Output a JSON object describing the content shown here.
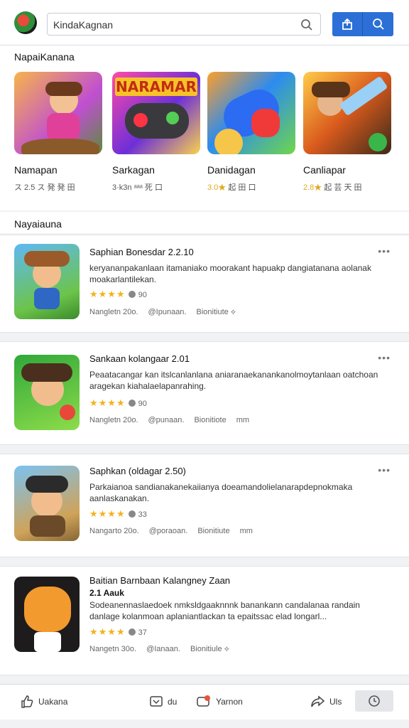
{
  "header": {
    "search_value": "KindaKagnan"
  },
  "featured": {
    "title": "NapaiKanana",
    "tiles": [
      {
        "name": "Namapan",
        "meta_highlight": "",
        "meta": "ス 2.5 ス 発 発 田"
      },
      {
        "name": "Sarkagan",
        "meta_highlight": "",
        "meta": "3·k3n ᵃᵃᵃ 死 口"
      },
      {
        "name": "Danidagan",
        "meta_highlight": "3.0★",
        "meta": " 起 田 口"
      },
      {
        "name": "Canliapar",
        "meta_highlight": "2.8★",
        "meta": " 起 芸 天 田"
      }
    ],
    "tile2_banner": "NARAMAR"
  },
  "list": {
    "title": "Nayaiauna",
    "items": [
      {
        "title": "Saphian Bonesdar 2.2.10",
        "desc": "keryananpakanlaan itamaniako moorakant hapuakp dangiatanana aolanak moakarlantilekan.",
        "stars": "★★★★",
        "count": "90",
        "foot": [
          "Nangletn 20o.",
          "@Ipunaan.",
          "Bionitiute ⟡"
        ]
      },
      {
        "title": "Sankaan kolangaar 2.01",
        "desc": "Peaatacangar kan itslcanlanlana aniaranaekanankanolmoytanlaan oatchoan aragekan kiahalaelapanrahing.",
        "stars": "★★★★",
        "count": "90",
        "foot": [
          "Nangletn 20o.",
          "@punaan.",
          "Bionitiote",
          "mm"
        ]
      },
      {
        "title": "Saphkan (oldagar 2.50)",
        "desc": "Parkaianoa sandianakanekaiianya doeamandolielanarapdepnokmaka aanlaskanakan.",
        "stars": "★★★★",
        "count": "33",
        "foot": [
          "Nangarto 20o.",
          "@poraoan.",
          "Bionitiute",
          "mm"
        ]
      },
      {
        "title": "Baitian Barnbaan Kalangney Zaan",
        "subtitle": "2.1 Aauk",
        "desc": "Sodeanennaslaedoek nmksldgaaknnnk banankann candalanaa randain danlage kolanmoan aplaniantlackan ta epaitssac elad longarl...",
        "stars": "★★★★",
        "count": "37",
        "foot": [
          "Nangetn 30o.",
          "@Ianaan.",
          "Bionitiule ⟡"
        ]
      }
    ]
  },
  "bottom_nav": {
    "like": "Uakana",
    "mid": "du",
    "report": "Yarnon",
    "share": "Uls"
  }
}
